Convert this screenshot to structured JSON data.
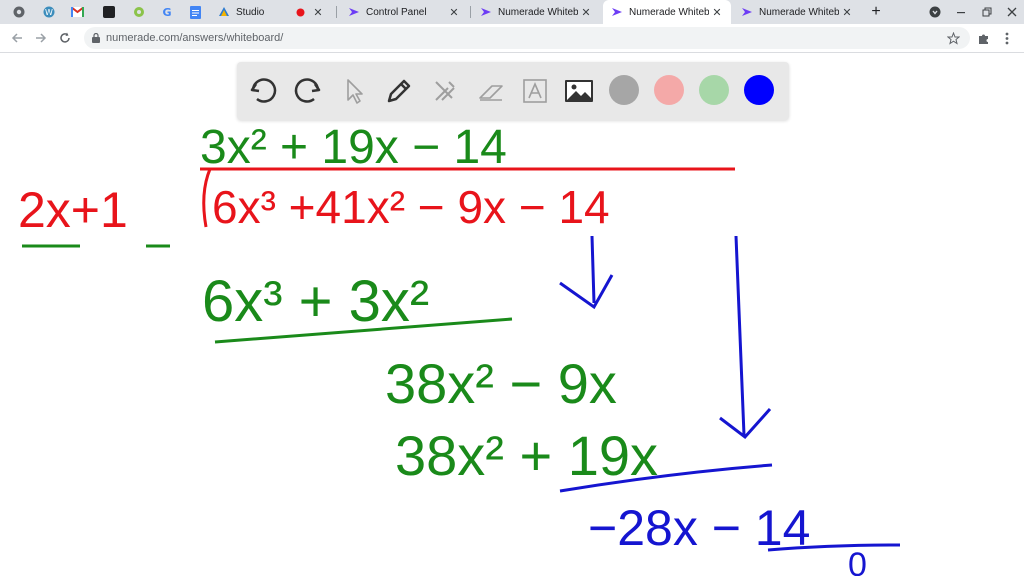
{
  "browser": {
    "tabs": [
      {
        "title": "Studio",
        "active": false
      },
      {
        "title": "Control Panel",
        "active": false
      },
      {
        "title": "Numerade Whiteboard",
        "active": false
      },
      {
        "title": "Numerade Whiteboard",
        "active": true
      },
      {
        "title": "Numerade Whiteboard",
        "active": false
      }
    ],
    "new_tab_label": "+",
    "url": "numerade.com/answers/whiteboard/"
  },
  "whiteboard_toolbar": {
    "tools": [
      "undo",
      "redo",
      "select",
      "pen",
      "tools",
      "eraser",
      "text",
      "image"
    ],
    "colors": [
      "#a6a6a6",
      "#f4a9a8",
      "#a7d7a8",
      "#0000ff"
    ],
    "selected_color": "#0000ff"
  },
  "whiteboard": {
    "divisor": "2x+1",
    "dividend": "6x³ +41x² − 9x − 14",
    "quotient": "3x² + 19x − 14",
    "step1_subtract": "6x³ + 3x²",
    "step2_remainder": "38x² − 9x",
    "step2_subtract": "38x² + 19x",
    "step3_remainder": "−28x − 14",
    "final_remainder": "0",
    "colors": {
      "red": "#e8141b",
      "green": "#1a8a1a",
      "blue": "#1515d0"
    }
  }
}
